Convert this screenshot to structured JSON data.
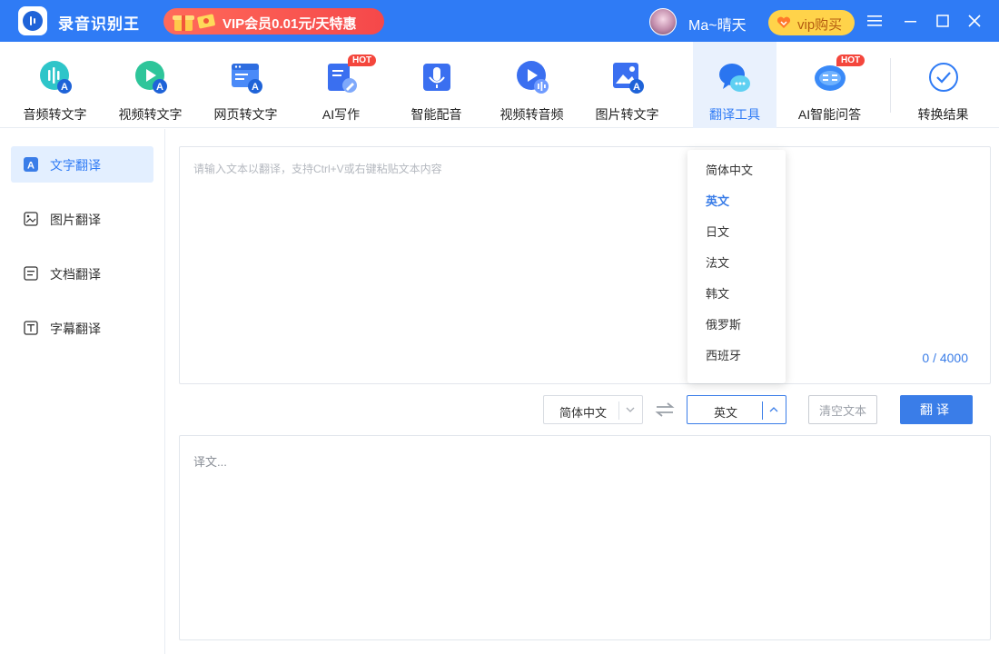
{
  "app": {
    "title": "录音识别王"
  },
  "header": {
    "promo_text": "VIP会员0.01元/天特惠",
    "username": "Ma~晴天",
    "vip_buy_label": "vip购买"
  },
  "toolbar": {
    "items": [
      {
        "label": "音频转文字",
        "icon": "audio-to-text-icon",
        "hot": false
      },
      {
        "label": "视频转文字",
        "icon": "video-to-text-icon",
        "hot": false
      },
      {
        "label": "网页转文字",
        "icon": "webpage-to-text-icon",
        "hot": false
      },
      {
        "label": "AI写作",
        "icon": "ai-writing-icon",
        "hot": true
      },
      {
        "label": "智能配音",
        "icon": "microphone-icon",
        "hot": false
      },
      {
        "label": "视频转音频",
        "icon": "video-to-audio-icon",
        "hot": false
      },
      {
        "label": "图片转文字",
        "icon": "image-to-text-icon",
        "hot": false
      },
      {
        "label": "翻译工具",
        "icon": "translate-tool-icon",
        "hot": false,
        "active": true
      },
      {
        "label": "AI智能问答",
        "icon": "ai-chat-icon",
        "hot": true
      },
      {
        "label": "转换结果",
        "icon": "check-circle-icon",
        "hot": false
      }
    ],
    "hot_badge": "HOT"
  },
  "sidebar": {
    "items": [
      {
        "label": "文字翻译",
        "icon": "text-translate-icon",
        "active": true
      },
      {
        "label": "图片翻译",
        "icon": "image-translate-icon",
        "active": false
      },
      {
        "label": "文档翻译",
        "icon": "document-translate-icon",
        "active": false
      },
      {
        "label": "字幕翻译",
        "icon": "subtitle-translate-icon",
        "active": false
      }
    ]
  },
  "input": {
    "placeholder": "请输入文本以翻译，支持Ctrl+V或右键粘贴文本内容",
    "value": "",
    "counter": "0 / 4000"
  },
  "controls": {
    "source_lang": "简体中文",
    "target_lang": "英文",
    "clear_label": "清空文本",
    "translate_label": "翻译"
  },
  "output": {
    "placeholder": "译文..."
  },
  "dropdown": {
    "options": [
      "简体中文",
      "英文",
      "日文",
      "法文",
      "韩文",
      "俄罗斯",
      "西班牙"
    ],
    "selected": "英文"
  },
  "colors": {
    "primary": "#2f7bf5",
    "hot": "#f4463c",
    "vip_gold": "#ffd34a",
    "promo_red": "#f5484a"
  }
}
